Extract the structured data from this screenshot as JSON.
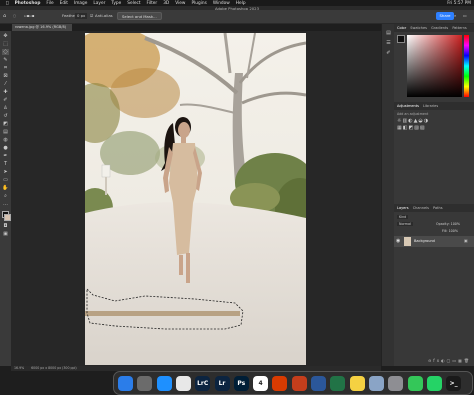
{
  "menubar": {
    "apple": "",
    "items": [
      "Photoshop",
      "File",
      "Edit",
      "Image",
      "Layer",
      "Type",
      "Select",
      "Filter",
      "3D",
      "View",
      "Plugins",
      "Window",
      "Help"
    ],
    "status_right": "Fri 5:57 PM"
  },
  "app_title": "Adobe Photoshop 2023",
  "options": {
    "feather_label": "Feather:",
    "feather_value": "0 px",
    "antialias_label": "Anti-alias",
    "select_mask_label": "Select and Mask...",
    "share_label": "Share"
  },
  "document": {
    "tab_label": "rowena.jpg @ 16.9% (RGB/8)"
  },
  "panels": {
    "color_tabs": [
      "Color",
      "Swatches",
      "Gradients",
      "Patterns"
    ],
    "adjust_tabs": [
      "Adjustments",
      "Libraries"
    ],
    "adjust_hint": "Add an adjustment",
    "layer_tabs": [
      "Layers",
      "Channels",
      "Paths"
    ],
    "layer_kind": "Kind",
    "layer_blend": "Normal",
    "layer_opacity": "Opacity: 100%",
    "layer_fill": "Fill: 100%",
    "background_layer": "Background"
  },
  "status": {
    "zoom": "16.9%",
    "dimensions": "6000 px x 8000 px (300 ppi)"
  },
  "dock": {
    "apps": [
      {
        "name": "finder",
        "label": "",
        "color": "#2b7de9"
      },
      {
        "name": "launchpad",
        "label": "",
        "color": "#6b6b6b"
      },
      {
        "name": "safari",
        "label": "",
        "color": "#1e90ff"
      },
      {
        "name": "chrome",
        "label": "",
        "color": "#e8e8e8"
      },
      {
        "name": "lightroom-classic",
        "label": "LrC",
        "color": "#0c2440"
      },
      {
        "name": "lightroom",
        "label": "Lr",
        "color": "#0c2440"
      },
      {
        "name": "photoshop",
        "label": "Ps",
        "color": "#001e36"
      },
      {
        "name": "calendar",
        "label": "4",
        "color": "#ffffff"
      },
      {
        "name": "office",
        "label": "",
        "color": "#d83b01"
      },
      {
        "name": "powerpoint",
        "label": "",
        "color": "#c43e1c"
      },
      {
        "name": "word",
        "label": "",
        "color": "#2b579a"
      },
      {
        "name": "excel",
        "label": "",
        "color": "#217346"
      },
      {
        "name": "notes",
        "label": "",
        "color": "#f5d142"
      },
      {
        "name": "preview",
        "label": "",
        "color": "#8aa4c6"
      },
      {
        "name": "settings",
        "label": "",
        "color": "#8e8e93"
      },
      {
        "name": "messages",
        "label": "",
        "color": "#34c759"
      },
      {
        "name": "whatsapp",
        "label": "",
        "color": "#25d366"
      },
      {
        "name": "terminal",
        "label": ">_",
        "color": "#1a1a1a"
      }
    ]
  },
  "colors": {
    "accent": "#2e80ff",
    "picker_hue": "#cc2222"
  }
}
